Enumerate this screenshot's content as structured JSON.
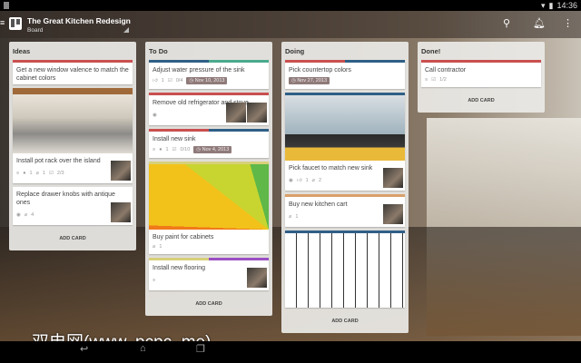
{
  "status": {
    "time": "14:36"
  },
  "appbar": {
    "title": "The Great Kitchen Redesign",
    "subtitle": "Board"
  },
  "watermark": "双电网(www. pcpc. me)",
  "add_card_label": "ADD CARD",
  "colors": {
    "red": "#c9504f",
    "blue": "#2f5f86",
    "green": "#4aaa8c",
    "orange": "#d9a06a",
    "yellow": "#d8d07a",
    "purple": "#9b4fc4"
  },
  "lists": [
    {
      "name": "Ideas",
      "cards": [
        {
          "title": "Get a new window valence to match the cabinet colors",
          "labels": [
            "red"
          ],
          "badges": []
        },
        {
          "title": "Install pot rack over the island",
          "labels": [],
          "cover": "pots",
          "badges": [
            {
              "icon": "description-icon",
              "text": ""
            },
            {
              "icon": "comment-icon",
              "text": "1"
            },
            {
              "icon": "attachment-icon",
              "text": "1"
            },
            {
              "icon": "checklist-icon",
              "text": "2/3"
            }
          ],
          "members": 1
        },
        {
          "title": "Replace drawer knobs with antique ones",
          "labels": [],
          "badges": [
            {
              "icon": "watch-icon",
              "text": ""
            },
            {
              "icon": "attachment-icon",
              "text": "4"
            }
          ],
          "members": 1
        }
      ]
    },
    {
      "name": "To Do",
      "cards": [
        {
          "title": "Adjust water pressure of the sink",
          "labels": [
            "blue",
            "green"
          ],
          "badges": [
            {
              "icon": "vote-icon",
              "text": "1"
            },
            {
              "icon": "checklist-icon",
              "text": "0/4"
            }
          ],
          "due": "Nov 10, 2013"
        },
        {
          "title": "Remove old refrigerator and stove",
          "labels": [
            "red"
          ],
          "badges": [
            {
              "icon": "watch-icon",
              "text": ""
            }
          ],
          "members": 2
        },
        {
          "title": "Install new sink",
          "labels": [
            "red",
            "blue"
          ],
          "badges": [
            {
              "icon": "description-icon",
              "text": ""
            },
            {
              "icon": "comment-icon",
              "text": "1"
            },
            {
              "icon": "checklist-icon",
              "text": "0/10"
            }
          ],
          "due": "Nov 4, 2013"
        },
        {
          "title": "Buy paint for cabinets",
          "labels": [
            "yellow"
          ],
          "cover": "paint",
          "badges": [
            {
              "icon": "attachment-icon",
              "text": "1"
            }
          ]
        },
        {
          "title": "Install new flooring",
          "labels": [
            "yellow",
            "purple"
          ],
          "badges": [
            {
              "icon": "description-icon",
              "text": ""
            }
          ],
          "members": 1
        }
      ]
    },
    {
      "name": "Doing",
      "cards": [
        {
          "title": "Pick countertop colors",
          "labels": [
            "red",
            "blue"
          ],
          "badges": [],
          "due": "Nov 27, 2013"
        },
        {
          "title": "Pick faucet to match new sink",
          "labels": [
            "blue"
          ],
          "cover": "faucet",
          "badges": [
            {
              "icon": "watch-icon",
              "text": ""
            },
            {
              "icon": "vote-icon",
              "text": "1"
            },
            {
              "icon": "attachment-icon",
              "text": "2"
            }
          ],
          "members": 1
        },
        {
          "title": "Buy new kitchen cart",
          "labels": [
            "orange"
          ],
          "badges": [
            {
              "icon": "attachment-icon",
              "text": "1"
            }
          ],
          "members": 1
        },
        {
          "title": "",
          "labels": [
            "blue"
          ],
          "cover": "floorplan",
          "badges": []
        }
      ]
    },
    {
      "name": "Done!",
      "cards": [
        {
          "title": "Call contractor",
          "labels": [
            "red"
          ],
          "badges": [
            {
              "icon": "description-icon",
              "text": ""
            },
            {
              "icon": "checklist-icon",
              "text": "1/2"
            }
          ]
        }
      ]
    }
  ]
}
